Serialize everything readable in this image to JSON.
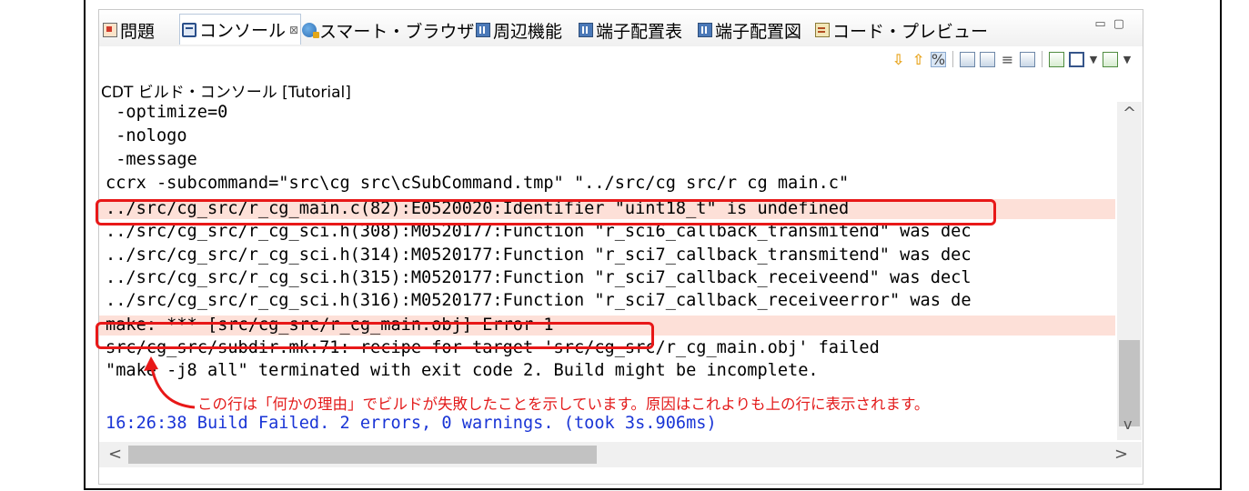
{
  "tabs": [
    {
      "label": "問題",
      "icon": "problems-icon"
    },
    {
      "label": "コンソール",
      "icon": "console-icon",
      "active": true,
      "close": "⊠"
    },
    {
      "label": "スマート・ブラウザー",
      "icon": "smart-browser-icon"
    },
    {
      "label": "周辺機能",
      "icon": "peripheral-icon"
    },
    {
      "label": "端子配置表",
      "icon": "pin-table-icon"
    },
    {
      "label": "端子配置図",
      "icon": "pin-diagram-icon"
    },
    {
      "label": "コード・プレビュー",
      "icon": "code-preview-icon"
    }
  ],
  "window_controls": {
    "minimize": "▭",
    "maximize": "▢"
  },
  "console": {
    "label": "CDT ビルド・コンソール [Tutorial]",
    "lines": [
      {
        "text": " -optimize=0"
      },
      {
        "text": " -nologo"
      },
      {
        "text": " -message"
      },
      {
        "text": "ccrx -subcommand=\"src\\cg src\\cSubCommand.tmp\" \"../src/cg src/r cg main.c\""
      },
      {
        "text": "../src/cg_src/r_cg_main.c(82):E0520020:Identifier \"uint18_t\" is undefined",
        "error": true
      },
      {
        "text": "../src/cg_src/r_cg_sci.h(308):M0520177:Function \"r_sci6_callback_transmitend\" was dec"
      },
      {
        "text": "../src/cg_src/r_cg_sci.h(314):M0520177:Function \"r_sci7_callback_transmitend\" was dec"
      },
      {
        "text": "../src/cg_src/r_cg_sci.h(315):M0520177:Function \"r_sci7_callback_receiveend\" was decl"
      },
      {
        "text": "../src/cg_src/r_cg_sci.h(316):M0520177:Function \"r_sci7_callback_receiveerror\" was de"
      },
      {
        "text": "make: *** [src/cg_src/r_cg_main.obj] Error 1",
        "error": true
      },
      {
        "text": "src/cg_src/subdir.mk:71: recipe for target 'src/cg_src/r_cg_main.obj' failed"
      },
      {
        "text": "\"make -j8 all\" terminated with exit code 2. Build might be incomplete."
      },
      {
        "text": ""
      },
      {
        "text": "16:26:38 Build Failed. 2 errors, 0 warnings. (took 3s.906ms)",
        "build": true
      }
    ]
  },
  "annotation": "この行は「何かの理由」でビルドが失敗したことを示しています。原因はこれよりも上の行に表示されます。",
  "scroll": {
    "up": "^",
    "down": "v",
    "left": "<",
    "right": ">"
  },
  "colors": {
    "error_bg": "#fde0d8",
    "annotation": "#e81818",
    "build_status": "#1a35d6"
  }
}
